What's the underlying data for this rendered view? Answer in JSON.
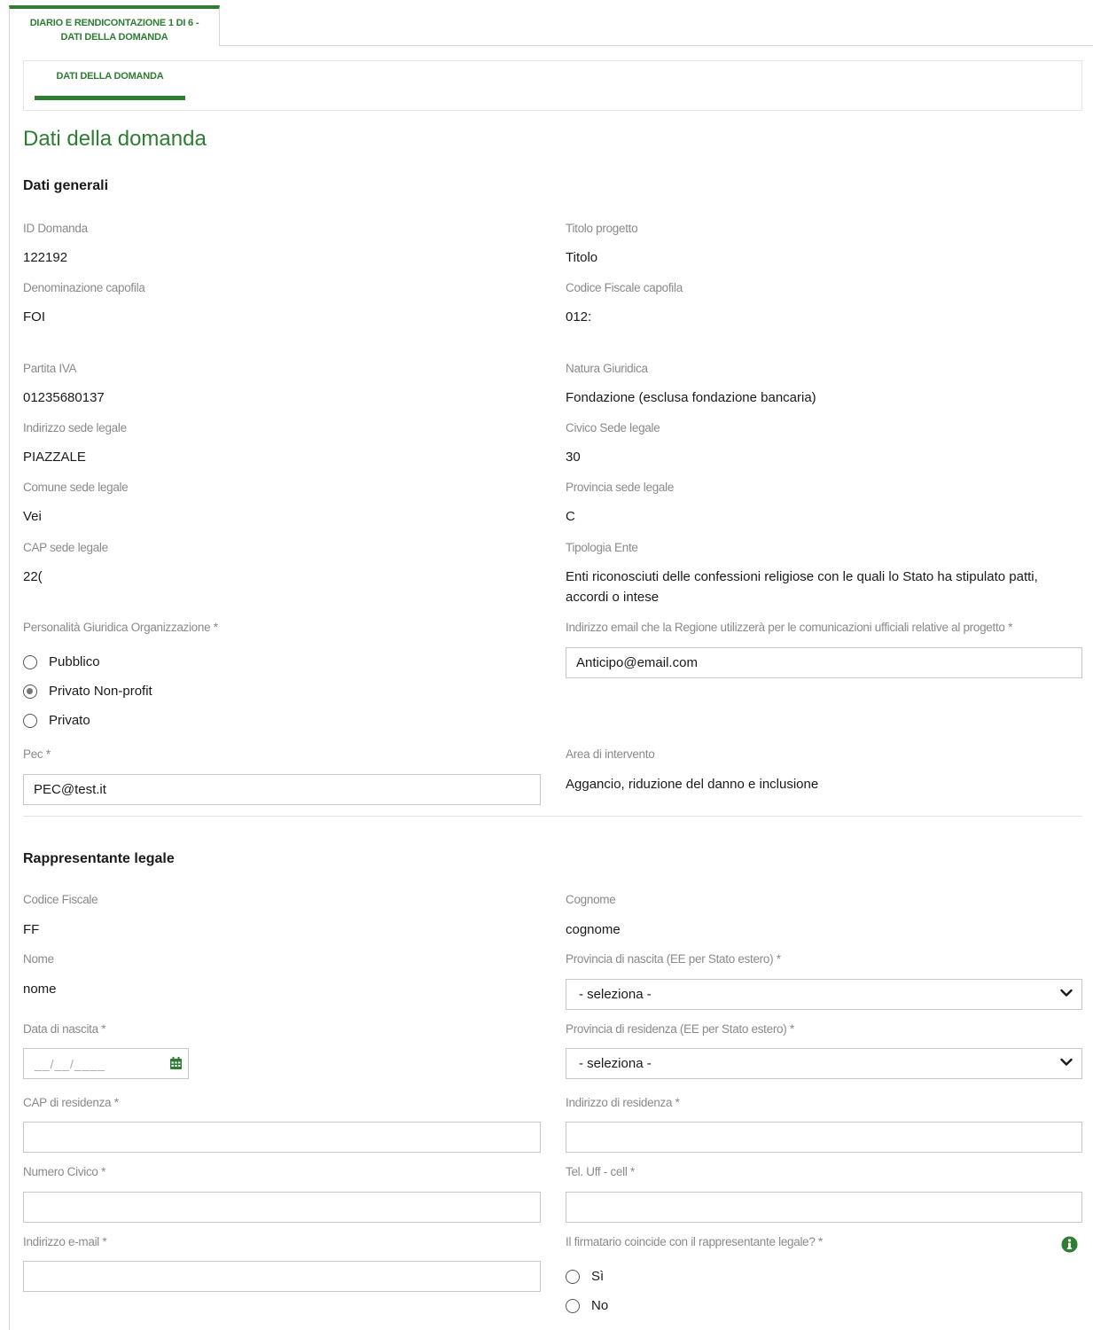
{
  "tab": {
    "line1": "DIARIO E RENDICONTAZIONE 1 DI 6 -",
    "line2": "DATI DELLA DOMANDA"
  },
  "subnav": {
    "label": "DATI DELLA DOMANDA"
  },
  "page_title": "Dati della domanda",
  "sections": {
    "general": "Dati generali",
    "legal_rep": "Rappresentante legale"
  },
  "general": {
    "id_domanda": {
      "label": "ID Domanda",
      "value": "122192"
    },
    "titolo_progetto": {
      "label": "Titolo progetto",
      "value": "Titolo"
    },
    "denominazione": {
      "label": "Denominazione capofila",
      "value": "FOI"
    },
    "codice_fiscale": {
      "label": "Codice Fiscale capofila",
      "value": "012:"
    },
    "partita_iva": {
      "label": "Partita IVA",
      "value": "01235680137"
    },
    "natura_giuridica": {
      "label": "Natura Giuridica",
      "value": "Fondazione (esclusa fondazione bancaria)"
    },
    "indirizzo_sede": {
      "label": "Indirizzo sede legale",
      "value": "PIAZZALE"
    },
    "civico_sede": {
      "label": "Civico Sede legale",
      "value": "30"
    },
    "comune_sede": {
      "label": "Comune sede legale",
      "value": "Vei"
    },
    "provincia_sede": {
      "label": "Provincia sede legale",
      "value": "C"
    },
    "cap_sede": {
      "label": "CAP sede legale",
      "value": "22("
    },
    "tipologia_ente": {
      "label": "Tipologia Ente",
      "value": "Enti riconosciuti delle confessioni religiose con le quali lo Stato ha stipulato patti, accordi o intese"
    },
    "personalita": {
      "label": "Personalità Giuridica Organizzazione *",
      "options": [
        "Pubblico",
        "Privato Non-profit",
        "Privato"
      ],
      "selected": "Privato Non-profit"
    },
    "email_regione": {
      "label": "Indirizzo email che la Regione utilizzerà per le comunicazioni ufficiali relative al progetto *",
      "value": "Anticipo@email.com"
    },
    "pec": {
      "label": "Pec *",
      "value": "PEC@test.it"
    },
    "area_intervento": {
      "label": "Area di intervento",
      "value": "Aggancio, riduzione del danno e inclusione"
    }
  },
  "legal": {
    "codice_fiscale": {
      "label": "Codice Fiscale",
      "value": "FF"
    },
    "cognome": {
      "label": "Cognome",
      "value": "cognome"
    },
    "nome": {
      "label": "Nome",
      "value": "nome"
    },
    "prov_nascita": {
      "label": "Provincia di nascita (EE per Stato estero) *",
      "value": "- seleziona -"
    },
    "data_nascita": {
      "label": "Data di nascita *",
      "placeholder": "__/__/____"
    },
    "prov_residenza": {
      "label": "Provincia di residenza (EE per Stato estero) *",
      "value": "- seleziona -"
    },
    "cap_residenza": {
      "label": "CAP di residenza *",
      "value": ""
    },
    "indirizzo_residenza": {
      "label": "Indirizzo di residenza *",
      "value": ""
    },
    "numero_civico": {
      "label": "Numero Civico *",
      "value": ""
    },
    "tel": {
      "label": "Tel. Uff - cell *",
      "value": ""
    },
    "email": {
      "label": "Indirizzo e-mail *",
      "value": ""
    },
    "firmatario": {
      "label": "Il firmatario coincide con il rappresentante legale? *",
      "options": [
        "Sì",
        "No"
      ]
    }
  },
  "colors": {
    "accent": "#2e7d32",
    "label": "#8a8a8a",
    "border": "#c8c8c8"
  }
}
